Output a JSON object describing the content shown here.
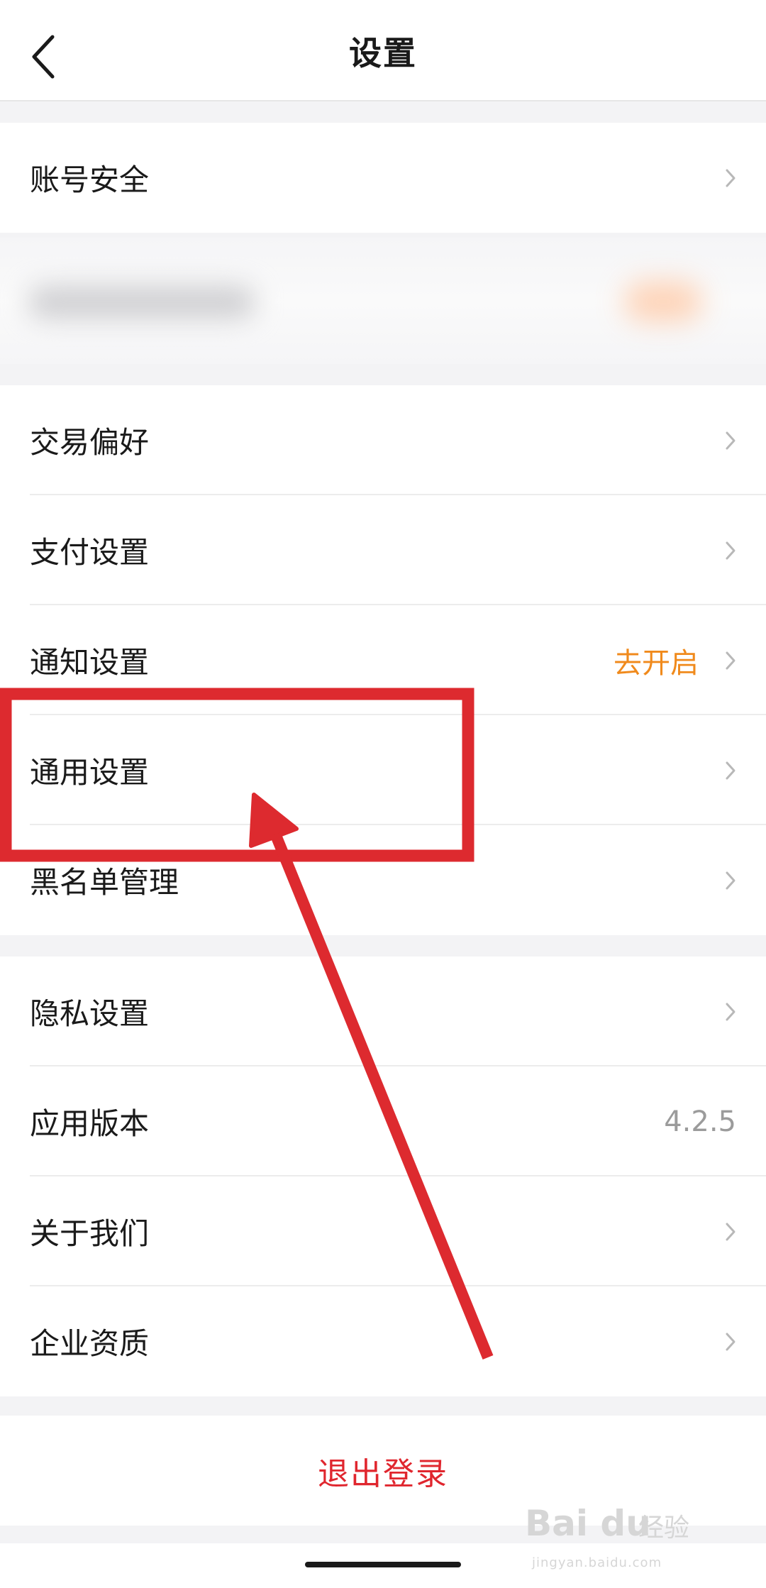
{
  "header": {
    "title": "设置"
  },
  "account": {
    "label": "账号安全"
  },
  "section1": [
    {
      "label": "交易偏好"
    },
    {
      "label": "支付设置"
    },
    {
      "label": "通知设置",
      "value": "去开启"
    },
    {
      "label": "通用设置"
    },
    {
      "label": "黑名单管理"
    }
  ],
  "section2": [
    {
      "label": "隐私设置"
    },
    {
      "label": "应用版本",
      "value": "4.2.5"
    },
    {
      "label": "关于我们"
    },
    {
      "label": "企业资质"
    }
  ],
  "logout": {
    "label": "退出登录"
  },
  "watermark": {
    "logo": "Bai du",
    "name": "经验",
    "url": "jingyan.baidu.com"
  },
  "colors": {
    "accent_orange": "#f08a1c",
    "logout_red": "#e0262e",
    "annotation_red": "#dd2a2f"
  },
  "icons": {
    "back": "chevron-left-icon",
    "row_chevron": "chevron-right-icon"
  }
}
